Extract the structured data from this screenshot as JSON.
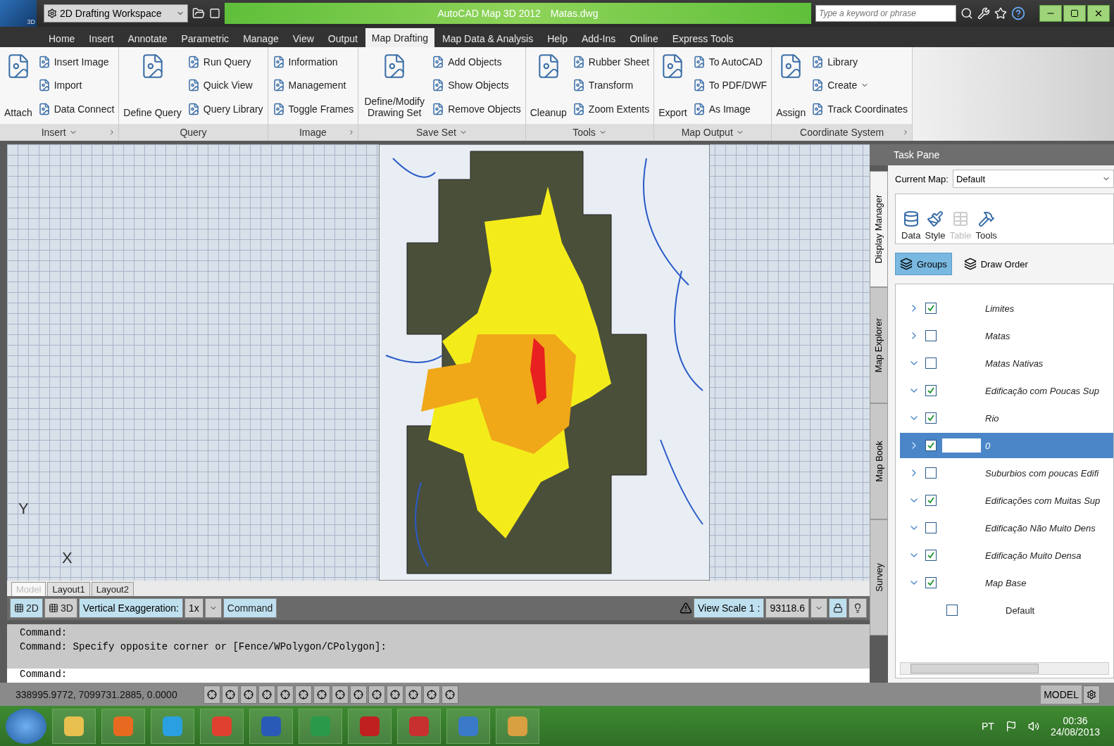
{
  "title_bar": {
    "app_badge": "3D",
    "workspace": "2D Drafting Workspace",
    "title": "AutoCAD Map 3D 2012",
    "file": "Matas.dwg",
    "search_placeholder": "Type a keyword or phrase"
  },
  "menu_tabs": [
    {
      "label": "Home",
      "selected": false
    },
    {
      "label": "Insert",
      "selected": false
    },
    {
      "label": "Annotate",
      "selected": false
    },
    {
      "label": "Parametric",
      "selected": false
    },
    {
      "label": "Manage",
      "selected": false
    },
    {
      "label": "View",
      "selected": false
    },
    {
      "label": "Output",
      "selected": false
    },
    {
      "label": "Map Drafting",
      "selected": true
    },
    {
      "label": "Map Data & Analysis",
      "selected": false
    },
    {
      "label": "Help",
      "selected": false
    },
    {
      "label": "Add-Ins",
      "selected": false
    },
    {
      "label": "Online",
      "selected": false
    },
    {
      "label": "Express Tools",
      "selected": false
    }
  ],
  "ribbon_panels": [
    {
      "title": "Insert",
      "dropdown": true,
      "launcher": true,
      "large": [
        "Attach"
      ],
      "small": [
        {
          "label": "Insert Image",
          "caret": false
        },
        {
          "label": "Import",
          "caret": false
        },
        {
          "label": "Data Connect",
          "caret": false
        }
      ]
    },
    {
      "title": "Query",
      "dropdown": false,
      "launcher": false,
      "large": [
        "Define Query"
      ],
      "small": [
        {
          "label": "Run Query",
          "caret": false
        },
        {
          "label": "Quick View",
          "caret": false
        },
        {
          "label": "Query Library",
          "caret": false
        }
      ]
    },
    {
      "title": "Image",
      "dropdown": false,
      "launcher": true,
      "small": [
        {
          "label": "Information",
          "caret": false
        },
        {
          "label": "Management",
          "caret": false
        },
        {
          "label": "Toggle Frames",
          "caret": false
        }
      ]
    },
    {
      "title": "Save Set",
      "dropdown": true,
      "launcher": false,
      "large": [
        "Define/Modify Drawing Set"
      ],
      "small": [
        {
          "label": "Add Objects",
          "caret": false
        },
        {
          "label": "Show Objects",
          "caret": false
        },
        {
          "label": "Remove Objects",
          "caret": false
        }
      ]
    },
    {
      "title": "Tools",
      "dropdown": true,
      "launcher": false,
      "large": [
        "Cleanup"
      ],
      "small": [
        {
          "label": "Rubber Sheet",
          "caret": false
        },
        {
          "label": "Transform",
          "caret": false
        },
        {
          "label": "Zoom Extents",
          "caret": false
        }
      ]
    },
    {
      "title": "Map Output",
      "dropdown": true,
      "launcher": false,
      "large": [
        "Export"
      ],
      "small": [
        {
          "label": "To AutoCAD",
          "caret": false
        },
        {
          "label": "To PDF/DWF",
          "caret": false
        },
        {
          "label": "As Image",
          "caret": false
        }
      ]
    },
    {
      "title": "Coordinate System",
      "dropdown": false,
      "launcher": true,
      "large": [
        "Assign"
      ],
      "small": [
        {
          "label": "Library",
          "caret": false
        },
        {
          "label": "Create",
          "caret": true
        },
        {
          "label": "Track Coordinates",
          "caret": false
        }
      ]
    }
  ],
  "viewport": {
    "axis_y": "Y",
    "axis_x": "X",
    "layout_tabs": [
      {
        "label": "Model",
        "selected": true
      },
      {
        "label": "Layout1",
        "selected": false
      },
      {
        "label": "Layout2",
        "selected": false
      }
    ]
  },
  "view_bar": {
    "mode_2d": "2D",
    "mode_3d": "3D",
    "exaggeration_label": "Vertical Exaggeration:",
    "exaggeration_value": "1x",
    "command_button": "Command",
    "scale_label": "View Scale  1 :",
    "scale_value": "93118.6"
  },
  "command_window": {
    "history": [
      "Command:",
      "Command: Specify opposite corner or [Fence/WPolygon/CPolygon]:"
    ],
    "prompt": "Command:"
  },
  "status_bar": {
    "coordinates": "338995.9772, 7099731.2885, 0.0000",
    "space": "MODEL"
  },
  "task_pane": {
    "title": "Task Pane",
    "side_tabs": [
      {
        "label": "Display Manager",
        "selected": true
      },
      {
        "label": "Map Explorer",
        "selected": false
      },
      {
        "label": "Map Book",
        "selected": false
      },
      {
        "label": "Survey",
        "selected": false
      }
    ],
    "current_map_label": "Current Map:",
    "current_map": "Default",
    "tools": [
      {
        "label": "Data",
        "disabled": false
      },
      {
        "label": "Style",
        "disabled": false
      },
      {
        "label": "Table",
        "disabled": true
      },
      {
        "label": "Tools",
        "disabled": false
      }
    ],
    "views": [
      {
        "label": "Groups",
        "selected": true
      },
      {
        "label": "Draw Order",
        "selected": false
      }
    ],
    "layers": [
      {
        "name": "Limites",
        "checked": true,
        "expanded": false,
        "selected": false
      },
      {
        "name": "Matas",
        "checked": false,
        "expanded": false,
        "selected": false
      },
      {
        "name": "Matas Nativas",
        "checked": false,
        "expanded": true,
        "selected": false
      },
      {
        "name": "Edificação com Poucas Sup",
        "checked": true,
        "expanded": true,
        "selected": false
      },
      {
        "name": "Rio",
        "checked": true,
        "expanded": true,
        "selected": false
      },
      {
        "name": "0",
        "checked": true,
        "expanded": false,
        "selected": true
      },
      {
        "name": "Suburbios com poucas Edifi",
        "checked": false,
        "expanded": false,
        "selected": false
      },
      {
        "name": "Edificações com Muitas Sup",
        "checked": true,
        "expanded": true,
        "selected": false
      },
      {
        "name": "Edificação Não Muito Dens",
        "checked": false,
        "expanded": true,
        "selected": false
      },
      {
        "name": "Edificação Muito Densa",
        "checked": true,
        "expanded": true,
        "selected": false
      },
      {
        "name": "Map Base",
        "checked": true,
        "expanded": true,
        "selected": false,
        "children": [
          {
            "name": "Default",
            "checked": false
          }
        ]
      }
    ]
  },
  "taskbar": {
    "language": "PT",
    "time": "00:36",
    "date": "24/08/2013"
  }
}
